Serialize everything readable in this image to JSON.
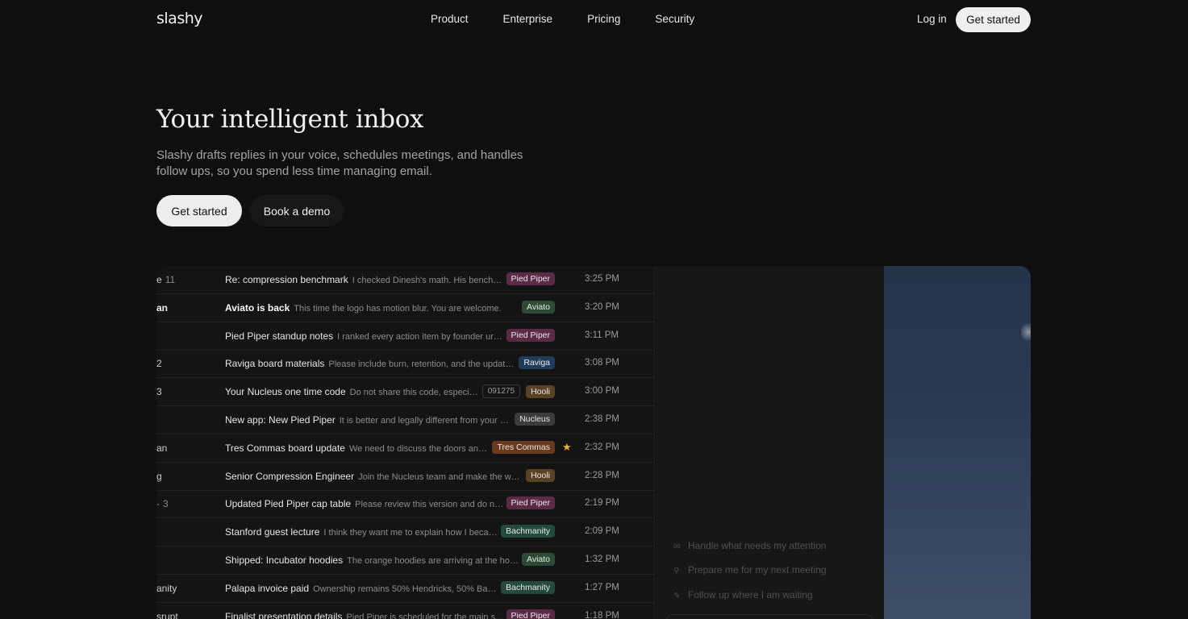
{
  "nav": {
    "logo": "slashy",
    "links": [
      "Product",
      "Enterprise",
      "Pricing",
      "Security"
    ],
    "login": "Log in",
    "cta": "Get started"
  },
  "hero": {
    "title": "Your intelligent inbox",
    "subtitle": "Slashy drafts replies in your voice, schedules meetings, and handles follow ups, so you spend less time managing email.",
    "primary_cta": "Get started",
    "secondary_cta": "Book a demo"
  },
  "inbox": {
    "rows": [
      {
        "sender": "e",
        "count": "11",
        "sender_bold": false,
        "subject": "Re: compression benchmark",
        "subject_bold": false,
        "snippet": "I checked Dinesh's math. His bench…",
        "code": "",
        "tag": "Pied Piper",
        "tag_color": "#5b2a45",
        "starred": false,
        "time": "3:25 PM"
      },
      {
        "sender": "an",
        "count": "",
        "sender_bold": true,
        "subject": "Aviato is back",
        "subject_bold": true,
        "snippet": "This time the logo has motion blur. You are welcome.",
        "code": "",
        "tag": "Aviato",
        "tag_color": "#2d4a36",
        "starred": false,
        "time": "3:20 PM"
      },
      {
        "sender": "",
        "count": "",
        "sender_bold": false,
        "subject": "Pied Piper standup notes",
        "subject_bold": false,
        "snippet": "I ranked every action item by founder ur…",
        "code": "",
        "tag": "Pied Piper",
        "tag_color": "#5b2a45",
        "starred": false,
        "time": "3:11 PM"
      },
      {
        "sender": "2",
        "count": "",
        "sender_bold": false,
        "subject": "Raviga board materials",
        "subject_bold": false,
        "snippet": "Please include burn, retention, and the updat…",
        "code": "",
        "tag": "Raviga",
        "tag_color": "#1f3d5a",
        "starred": false,
        "time": "3:08 PM"
      },
      {
        "sender": "3",
        "count": "",
        "sender_bold": false,
        "subject": "Your Nucleus one time code",
        "subject_bold": false,
        "snippet": "Do not share this code, especi…",
        "code": "091275",
        "tag": "Hooli",
        "tag_color": "#5a4324",
        "starred": false,
        "time": "3:00 PM"
      },
      {
        "sender": "",
        "count": "",
        "sender_bold": false,
        "subject": "New app: New Pied Piper",
        "subject_bold": false,
        "snippet": "It is better and legally different from your …",
        "code": "",
        "tag": "Nucleus",
        "tag_color": "#3b3b3e",
        "starred": false,
        "time": "2:38 PM"
      },
      {
        "sender": "an",
        "count": "",
        "sender_bold": false,
        "subject": "Tres Commas board update",
        "subject_bold": false,
        "snippet": "We need to discuss the doors an…",
        "code": "",
        "tag": "Tres Commas",
        "tag_color": "#6a3a1e",
        "starred": true,
        "time": "2:32 PM"
      },
      {
        "sender": "g",
        "count": "",
        "sender_bold": false,
        "subject": "Senior Compression Engineer",
        "subject_bold": false,
        "snippet": "Join the Nucleus team and make the w…",
        "code": "",
        "tag": "Hooli",
        "tag_color": "#5a4324",
        "starred": false,
        "time": "2:28 PM"
      },
      {
        "sender": "·",
        "count": "3",
        "sender_bold": false,
        "subject": "Updated Pied Piper cap table",
        "subject_bold": false,
        "snippet": "Please review this version and do n…",
        "code": "",
        "tag": "Pied Piper",
        "tag_color": "#5b2a45",
        "starred": false,
        "time": "2:19 PM"
      },
      {
        "sender": "",
        "count": "",
        "sender_bold": false,
        "subject": "Stanford guest lecture",
        "subject_bold": false,
        "snippet": "I think they want me to explain how I beca…",
        "code": "",
        "tag": "Bachmanity",
        "tag_color": "#244a3c",
        "starred": false,
        "time": "2:09 PM"
      },
      {
        "sender": "",
        "count": "",
        "sender_bold": false,
        "subject": "Shipped: Incubator hoodies",
        "subject_bold": false,
        "snippet": "The orange hoodies are arriving at the ho…",
        "code": "",
        "tag": "Aviato",
        "tag_color": "#2d4a36",
        "starred": false,
        "time": "1:32 PM"
      },
      {
        "sender": "anity",
        "count": "",
        "sender_bold": false,
        "subject": "Palapa invoice paid",
        "subject_bold": false,
        "snippet": "Ownership remains 50% Hendricks, 50% Ba…",
        "code": "",
        "tag": "Bachmanity",
        "tag_color": "#244a3c",
        "starred": false,
        "time": "1:27 PM"
      },
      {
        "sender": "srupt",
        "count": "",
        "sender_bold": false,
        "subject": "Finalist presentation details",
        "subject_bold": false,
        "snippet": "Pied Piper is scheduled for the main s…",
        "code": "",
        "tag": "Pied Piper",
        "tag_color": "#5b2a45",
        "starred": false,
        "time": "1:18 PM"
      }
    ]
  },
  "assistant": {
    "suggestions": [
      {
        "icon": "mail-icon",
        "label": "Handle what needs my attention"
      },
      {
        "icon": "search-icon",
        "label": "Prepare me for my next meeting"
      },
      {
        "icon": "pencil-icon",
        "label": "Follow up where I am waiting"
      }
    ]
  },
  "colors": {
    "background": "#0f0f10",
    "star": "#f2b02e",
    "photo_sky": "#2a3a52"
  }
}
